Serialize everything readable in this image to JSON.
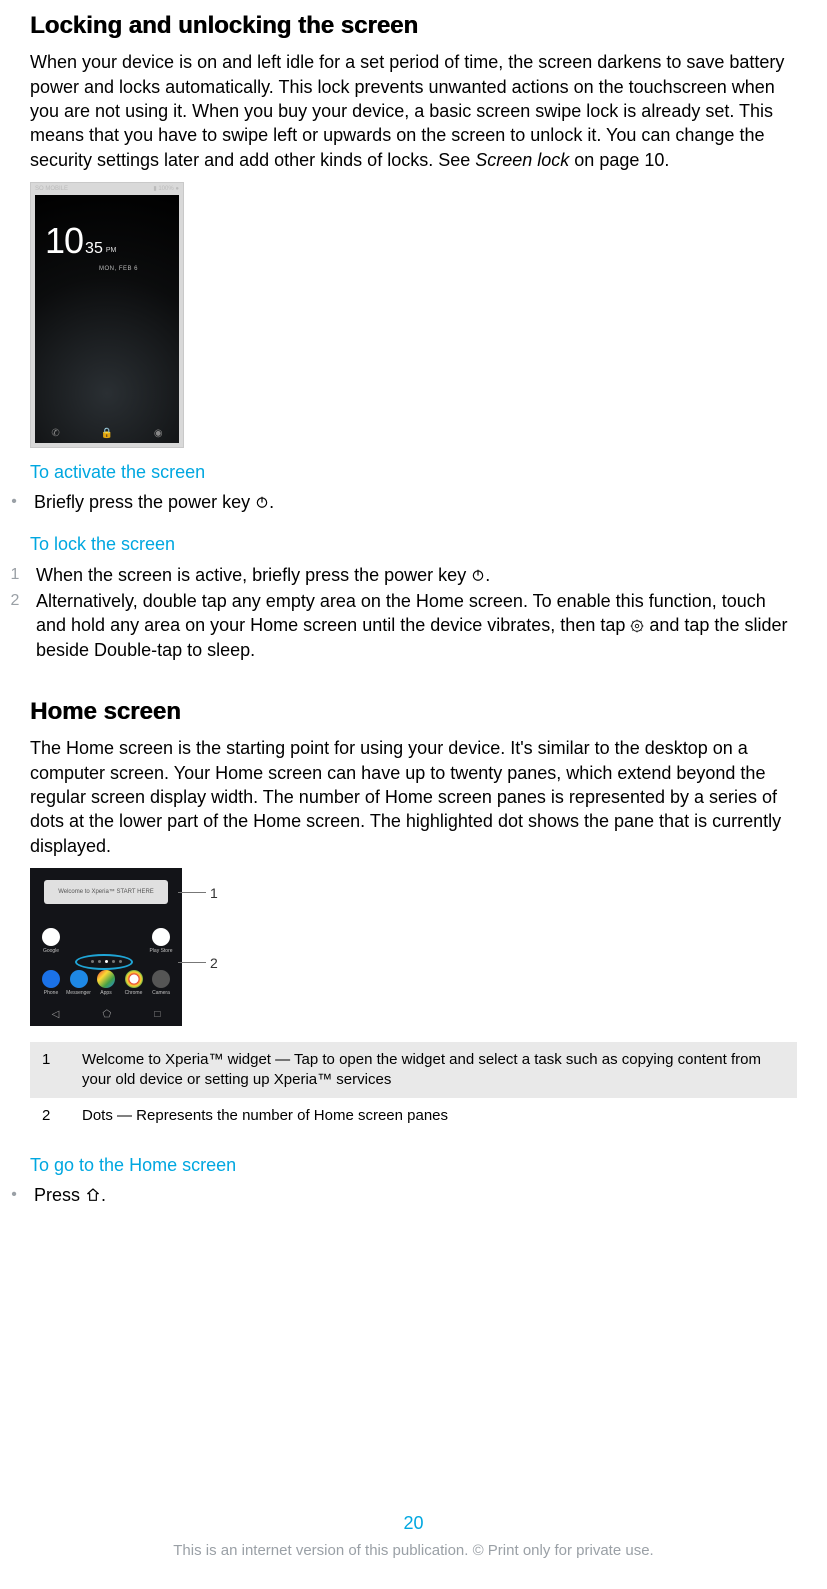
{
  "sec1": {
    "heading": "Locking and unlocking the screen",
    "para_a": "When your device is on and left idle for a set period of time, the screen darkens to save battery power and locks automatically. This lock prevents unwanted actions on the touchscreen when you are not using it. When you buy your device, a basic screen swipe lock is already set. This means that you have to swipe left or upwards on the screen to unlock it. You can change the security settings later and add other kinds of locks. See ",
    "para_ref": "Screen lock",
    "para_b": " on page 10.",
    "sub1": "To activate the screen",
    "step1_a": "Briefly press the power key ",
    "step1_b": ".",
    "sub2": "To lock the screen",
    "lock_step1_a": "When the screen is active, briefly press the power key ",
    "lock_step1_b": ".",
    "lock_step2_a": "Alternatively, double tap any empty area on the Home screen. To enable this function, touch and hold any area on your Home screen until the device vibrates, then tap ",
    "lock_step2_b": " and tap the slider beside Double-tap to sleep.",
    "lock_illus": {
      "carrier": "SO MOBILE",
      "batt": "100%",
      "time_big": "10",
      "time_sm": "35",
      "ampm": "PM",
      "date": "MON, FEB 6"
    }
  },
  "sec2": {
    "heading": "Home screen",
    "para": "The Home screen is the starting point for using your device. It's similar to the desktop on a computer screen. Your Home screen can have up to twenty panes, which extend beyond the regular screen display width. The number of Home screen panes is represented by a series of dots at the lower part of the Home screen. The highlighted dot shows the pane that is currently displayed.",
    "banner": "Welcome to Xperia™  START HERE",
    "apps": [
      "Google",
      "Play Store",
      "Phone",
      "Messenger",
      "Apps",
      "Chrome",
      "Camera"
    ],
    "callouts": [
      {
        "n": "1",
        "t": "Welcome to Xperia™ widget — Tap to open the widget and select a task such as copying content from your old device or setting up Xperia™ services"
      },
      {
        "n": "2",
        "t": "Dots — Represents the number of Home screen panes"
      }
    ],
    "sub1": "To go to the Home screen",
    "gohome_a": "Press ",
    "gohome_b": "."
  },
  "page_number": "20",
  "footer": "This is an internet version of this publication. © Print only for private use."
}
